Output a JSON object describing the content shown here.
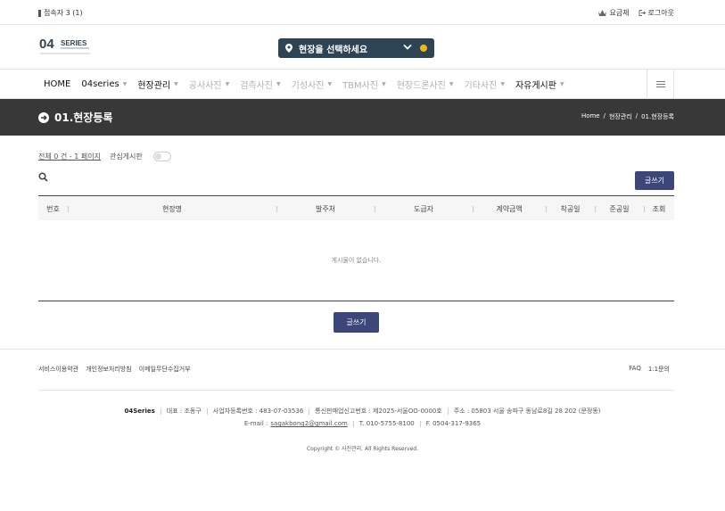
{
  "topbar": {
    "visitors": "접속자 3 (1)",
    "pricing": "요금제",
    "logout": "로그아웃"
  },
  "logo": {
    "text": "SERIES",
    "number": "04"
  },
  "site_select": {
    "label": "현장을 선택하세요"
  },
  "nav": {
    "items": [
      {
        "label": "HOME",
        "caret": ""
      },
      {
        "label": "04series",
        "caret": "▼"
      },
      {
        "label": "현장관리",
        "caret": "▼"
      },
      {
        "label": "공사사진",
        "caret": "▼"
      },
      {
        "label": "검측사진",
        "caret": "▼"
      },
      {
        "label": "기성사진",
        "caret": "▼"
      },
      {
        "label": "TBM사진",
        "caret": "▼"
      },
      {
        "label": "현장드론사진",
        "caret": "▼"
      },
      {
        "label": "기타사진",
        "caret": "▼"
      },
      {
        "label": "자유게시판",
        "caret": "▼"
      }
    ]
  },
  "banner": {
    "title": "01.현장등록",
    "crumb_home": "Home",
    "crumb_sep": "/",
    "crumb_mid": "현장관리",
    "crumb_current": "01.현장등록"
  },
  "board": {
    "count": "전체 0 건 - 1 페이지",
    "interest": "관심게시판",
    "write": "글쓰기",
    "empty": "게시물이 없습니다."
  },
  "table": {
    "headers": [
      "번호",
      "현장명",
      "발주처",
      "도급자",
      "계약금액",
      "착공일",
      "준공일",
      "조회"
    ]
  },
  "footer": {
    "links": [
      "서비스이용약관",
      "개인정보처리방침",
      "이메일무단수집거부"
    ],
    "right_links": [
      "FAQ",
      "1:1문의"
    ],
    "company_name": "04Series",
    "ceo": "대표 : 조동구",
    "biz_no": "사업자등록번호 : 483-07-03536",
    "mail_order": "통신판매업신고번호 : 제2025-서울OO-0000호",
    "address": "주소 : 05803 서울 송파구 동남로8길 28 202 (문정동)",
    "email_label": "E-mail :",
    "email": "sagakbong2@gmail.com",
    "tel": "T. 010-5755-8100",
    "fax": "F. 0504-317-9365",
    "copyright": "Copyright © 사진관리. All Rights Reserved."
  },
  "colors": {
    "banner_bg": "#383838",
    "select_bg": "#2d4454",
    "button_bg": "#3d4679",
    "plus_accent": "#f2b417"
  }
}
